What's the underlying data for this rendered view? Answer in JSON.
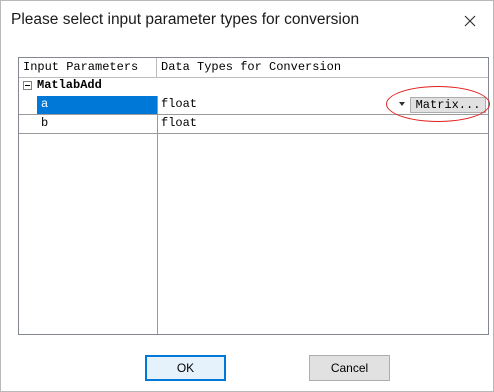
{
  "dialog": {
    "title": "Please select input parameter types for conversion",
    "close_glyph": "✕"
  },
  "grid": {
    "columns": [
      "Input Parameters",
      "Data Types for Conversion"
    ],
    "group": {
      "label": "MatlabAdd",
      "expander_state": "expanded",
      "expander_icon": "minus-box-icon"
    },
    "rows": [
      {
        "param": "a",
        "type": "float",
        "selected": true,
        "button_label": "Matrix..."
      },
      {
        "param": "b",
        "type": "float",
        "selected": false
      }
    ]
  },
  "annotation": {
    "color": "#e02020"
  },
  "buttons": {
    "ok": "OK",
    "cancel": "Cancel"
  }
}
